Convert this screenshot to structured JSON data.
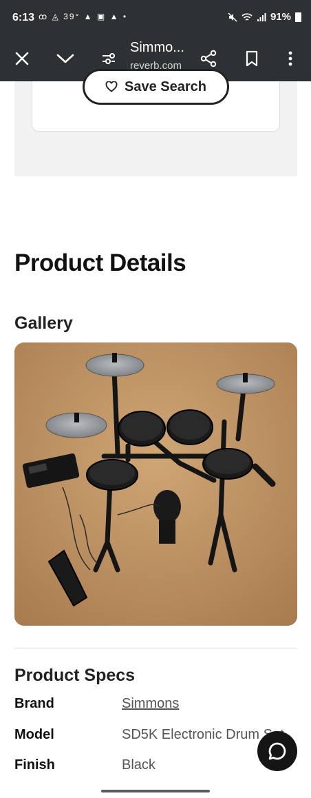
{
  "status_bar": {
    "time": "6:13",
    "temperature": "39°",
    "battery": "91%",
    "icons_left": [
      "voicemail-icon",
      "photos-icon",
      "alert-icon",
      "image-icon",
      "alert-icon",
      "dot-icon"
    ],
    "icons_right": [
      "mute-icon",
      "wifi-icon",
      "signal-icon",
      "battery-icon"
    ]
  },
  "toolbar": {
    "title": "Simmo...",
    "url": "reverb.com",
    "icons": [
      "close-icon",
      "chevron-down-icon",
      "page-settings-icon",
      "share-icon",
      "bookmark-icon",
      "more-vert-icon"
    ]
  },
  "save_search": {
    "label": "Save Search",
    "icon": "heart-icon"
  },
  "product_details": {
    "heading": "Product Details"
  },
  "gallery": {
    "heading": "Gallery",
    "image_alt": "electronic drum kit photo"
  },
  "specs": {
    "heading": "Product Specs",
    "rows": [
      {
        "label": "Brand",
        "value": "Simmons"
      },
      {
        "label": "Model",
        "value": "SD5K Electronic Drum Set"
      },
      {
        "label": "Finish",
        "value": "Black"
      }
    ]
  },
  "chat": {
    "icon": "chat-bubble-icon"
  }
}
